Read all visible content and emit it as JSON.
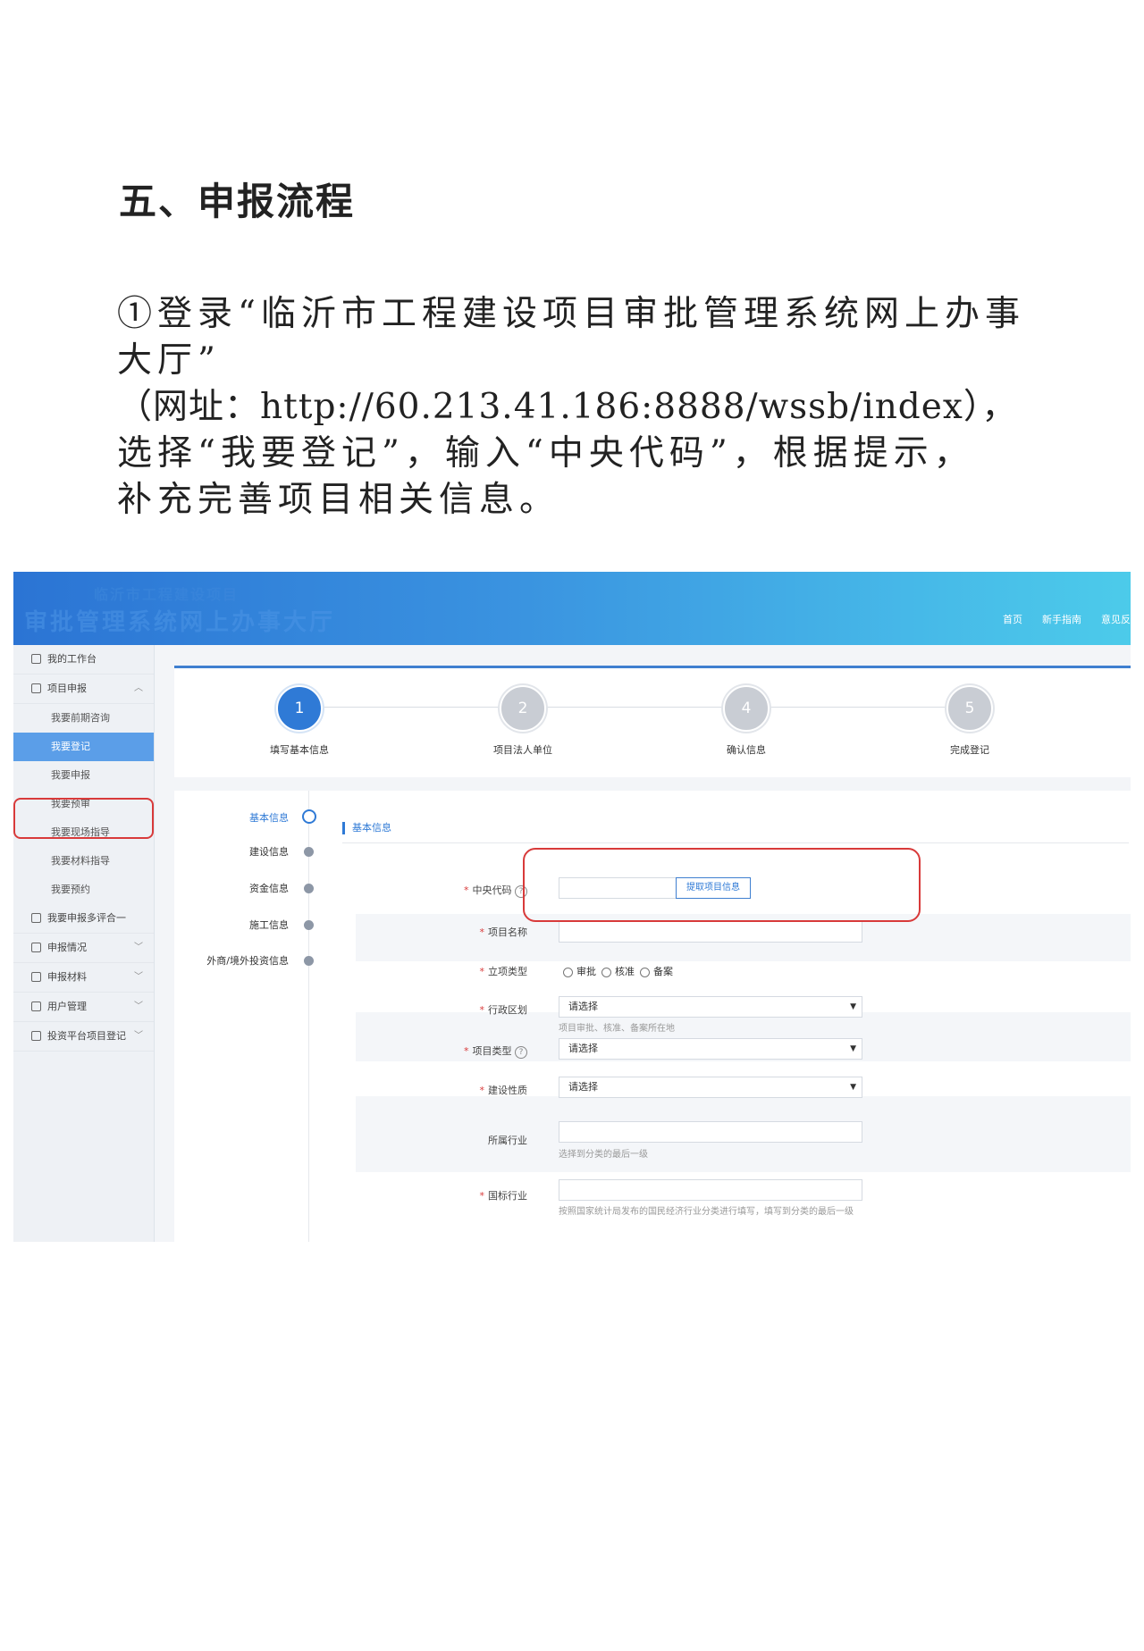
{
  "doc": {
    "heading": "五、申报流程",
    "para_lines": [
      "①登录“临沂市工程建设项目审批管理系统网上办事",
      "大厅”",
      "（网址：http://60.213.41.186:8888/wssb/index），",
      "选择“我要登记”，输入“中央代码”，根据提示，",
      "补充完善项目相关信息。"
    ]
  },
  "screenshot": {
    "banner": {
      "subtitle": "临沂市工程建设项目",
      "title": "审批管理系统网上办事大厅",
      "nav": [
        "首页",
        "新手指南",
        "意见反"
      ]
    },
    "sidebar": {
      "workbench": "我的工作台",
      "project_report": "项目申报",
      "sub_items": [
        "我要前期咨询",
        "我要登记",
        "我要申报",
        "我要预审",
        "我要现场指导",
        "我要材料指导",
        "我要预约"
      ],
      "active_sub": "我要登记",
      "items": [
        "我要申报多评合一",
        "申报情况",
        "申报材料",
        "用户管理",
        "投资平台项目登记"
      ]
    },
    "steps": [
      {
        "num": "1",
        "label": "填写基本信息",
        "active": true
      },
      {
        "num": "2",
        "label": "项目法人单位",
        "active": false
      },
      {
        "num": "4",
        "label": "确认信息",
        "active": false
      },
      {
        "num": "5",
        "label": "完成登记",
        "active": false
      }
    ],
    "vnav": [
      "基本信息",
      "建设信息",
      "资金信息",
      "施工信息",
      "外商/境外投资信息"
    ],
    "section_title": "基本信息",
    "form": {
      "central_code_label": "中央代码",
      "help_mark": "?",
      "fetch_button": "提取项目信息",
      "project_name_label": "项目名称",
      "approval_type_label": "立项类型",
      "approval_options": [
        "审批",
        "核准",
        "备案"
      ],
      "region_label": "行政区划",
      "region_value": "请选择",
      "region_hint": "项目审批、核准、备案所在地",
      "project_type_label": "项目类型",
      "project_type_value": "请选择",
      "nature_label": "建设性质",
      "nature_value": "请选择",
      "industry_label": "所属行业",
      "industry_hint": "选择到分类的最后一级",
      "national_industry_label": "国标行业",
      "national_industry_hint": "按照国家统计局发布的国民经济行业分类进行填写，填写到分类的最后一级"
    }
  }
}
